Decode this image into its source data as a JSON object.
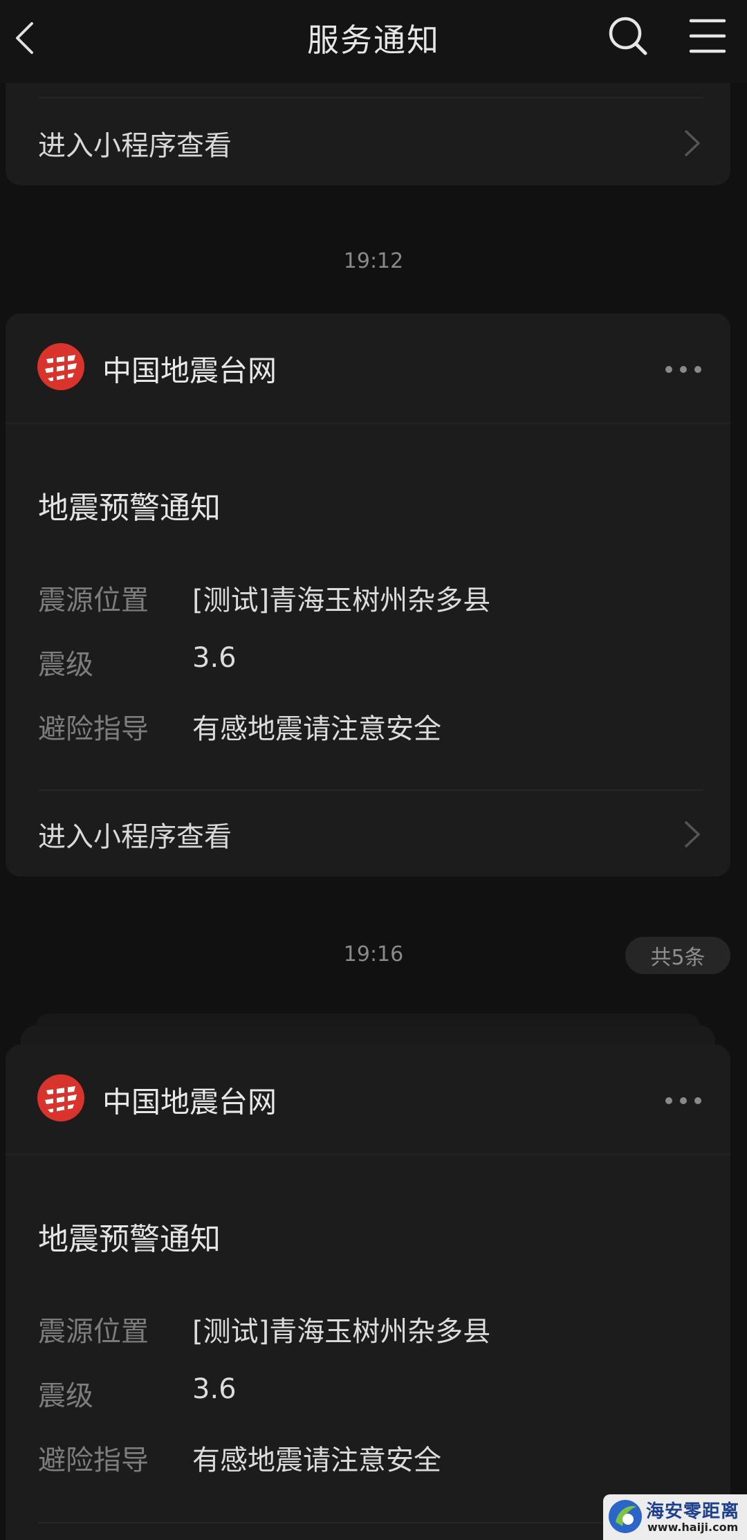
{
  "header": {
    "title": "服务通知",
    "back_icon": "chevron-left-icon",
    "search_icon": "search-icon",
    "menu_icon": "menu-icon"
  },
  "previous_card": {
    "enter_label": "进入小程序查看"
  },
  "messages": [
    {
      "time": "19:12",
      "org_name": "中国地震台网",
      "notice_title": "地震预警通知",
      "fields": [
        {
          "label": "震源位置",
          "value": "[测试]青海玉树州杂多县"
        },
        {
          "label": "震级",
          "value": "3.6"
        },
        {
          "label": "避险指导",
          "value": "有感地震请注意安全"
        }
      ],
      "enter_label": "进入小程序查看"
    },
    {
      "time": "19:16",
      "badge": "共5条",
      "org_name": "中国地震台网",
      "notice_title": "地震预警通知",
      "fields": [
        {
          "label": "震源位置",
          "value": "[测试]青海玉树州杂多县"
        },
        {
          "label": "震级",
          "value": "3.6"
        },
        {
          "label": "避险指导",
          "value": "有感地震请注意安全"
        }
      ]
    }
  ],
  "watermark": {
    "name": "海安零距离",
    "url": "www.haiji.com"
  },
  "colors": {
    "background": "#111111",
    "card": "#1c1c1c",
    "logo_red": "#d9342b",
    "label_gray": "#7d7d7d"
  }
}
